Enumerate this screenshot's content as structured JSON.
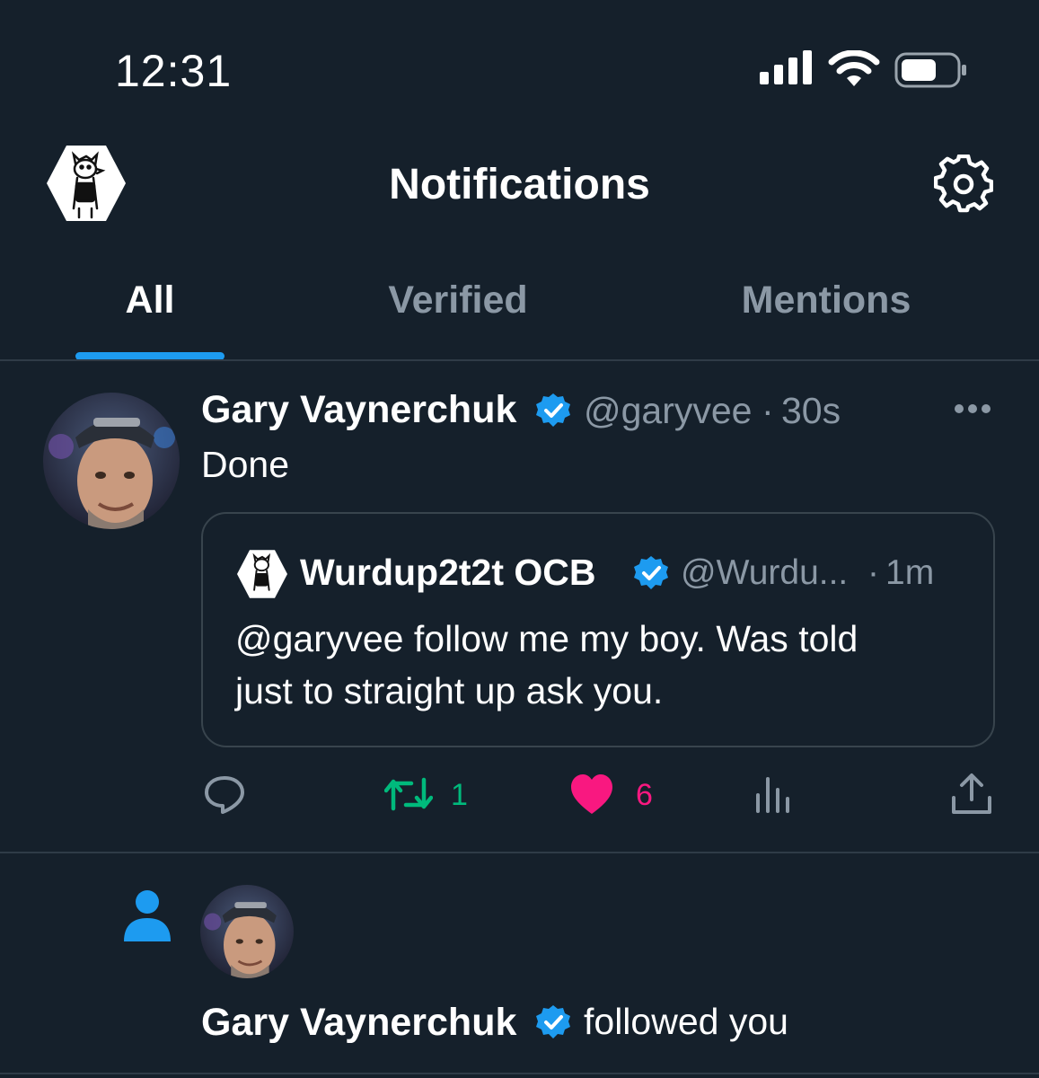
{
  "status_bar": {
    "time": "12:31"
  },
  "header": {
    "title": "Notifications",
    "avatar_icon": "cartoon-character-avatar",
    "settings_icon": "gear-icon"
  },
  "tabs": [
    {
      "label": "All",
      "active": true
    },
    {
      "label": "Verified",
      "active": false
    },
    {
      "label": "Mentions",
      "active": false
    }
  ],
  "tweet": {
    "author_name": "Gary Vaynerchuk",
    "author_handle": "@garyvee",
    "separator": "·",
    "time": "30s",
    "text": "Done",
    "quoted": {
      "author_name": "Wurdup2t2t OCB",
      "author_handle": "@Wurdu...",
      "separator": "·",
      "time": "1m",
      "text_line1": "@garyvee follow me my boy. Was told",
      "text_line2": "just to straight up ask you."
    },
    "actions": {
      "retweets": "1",
      "likes": "6"
    }
  },
  "follow_notification": {
    "name": "Gary Vaynerchuk",
    "action_text": "followed you"
  },
  "colors": {
    "background": "#15202b",
    "accent": "#1d9bf0",
    "muted": "#8b98a5",
    "retweet": "#00ba7c",
    "like": "#f91880"
  }
}
